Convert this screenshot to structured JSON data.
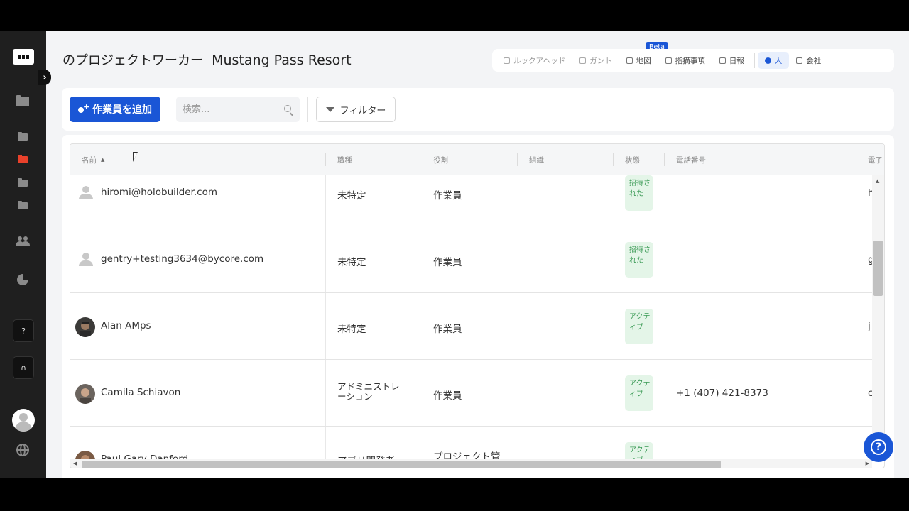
{
  "header": {
    "title_prefix": "のプロジェクトワーカー",
    "project_name": "Mustang Pass Resort"
  },
  "view_switch": {
    "items": [
      {
        "label": "ルックアヘッド",
        "icon": "lookahead-icon"
      },
      {
        "label": "ガント",
        "icon": "gantt-icon"
      },
      {
        "label": "地図",
        "icon": "map-icon"
      },
      {
        "label": "指摘事項",
        "icon": "issues-icon"
      },
      {
        "label": "日報",
        "icon": "daily-report-icon"
      },
      {
        "label": "人",
        "icon": "people-icon"
      },
      {
        "label": "会社",
        "icon": "company-icon"
      }
    ],
    "beta_label": "Beta",
    "active": "人"
  },
  "toolbar": {
    "add_label": "作業員を追加",
    "search_placeholder": "検索...",
    "filter_label": "フィルター"
  },
  "table": {
    "columns": [
      "名前",
      "職種",
      "役割",
      "組織",
      "状態",
      "電話番号",
      "電子"
    ],
    "rows": [
      {
        "name": "hiromi@holobuilder.com",
        "trade": "未特定",
        "role": "作業員",
        "org": "",
        "status": "招待された",
        "phone": "",
        "email_partial": "h",
        "avatar": "default"
      },
      {
        "name": "gentry+testing3634@bycore.com",
        "trade": "未特定",
        "role": "作業員",
        "org": "",
        "status": "招待された",
        "phone": "",
        "email_partial": "g",
        "avatar": "default"
      },
      {
        "name": "Alan AMps",
        "trade": "未特定",
        "role": "作業員",
        "org": "",
        "status": "アクティブ",
        "phone": "",
        "email_partial": "j",
        "avatar": "photo"
      },
      {
        "name": "Camila Schiavon",
        "trade": "アドミニストレーション",
        "role": "作業員",
        "org": "",
        "status": "アクティブ",
        "phone": "+1 (407) 421-8373",
        "email_partial": "c",
        "avatar": "photo"
      },
      {
        "name": "Paul Gary Danford",
        "trade": "アプリ開発者",
        "role": "プロジェクト管",
        "org": "",
        "status": "アクティブ",
        "phone": "",
        "email_partial": "",
        "avatar": "photo"
      }
    ]
  },
  "colors": {
    "primary": "#1a56d6",
    "sidebar": "#1f1f1f",
    "status_green": "#3a9a55",
    "folder_active": "#e8412b"
  }
}
